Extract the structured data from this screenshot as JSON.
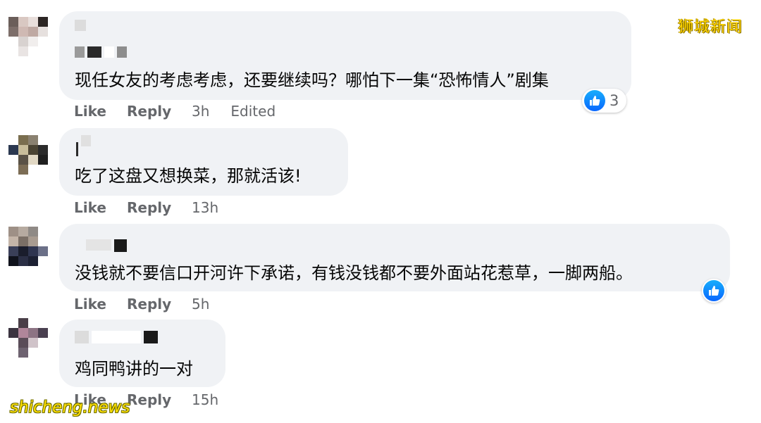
{
  "watermarks": {
    "top_right": "狮城新闻",
    "bottom_left": "shicheng.news"
  },
  "comments": [
    {
      "text": "现任女友的考虑考虑，还要继续吗？哪怕下一集“恐怖情人”剧集",
      "actions": {
        "like": "Like",
        "reply": "Reply",
        "time": "3h",
        "edited": "Edited"
      },
      "reaction": {
        "icon": "like-icon",
        "count": "3"
      }
    },
    {
      "text": "吃了这盘又想换菜，那就活该!",
      "actions": {
        "like": "Like",
        "reply": "Reply",
        "time": "13h"
      }
    },
    {
      "text": "没钱就不要信口开河许下承诺，有钱没钱都不要外面站花惹草，一脚两船。",
      "actions": {
        "like": "Like",
        "reply": "Reply",
        "time": "5h"
      },
      "reaction": {
        "icon": "like-icon"
      }
    },
    {
      "text": "鸡同鸭讲的一对",
      "actions": {
        "like": "Like",
        "reply": "Reply",
        "time": "15h"
      }
    }
  ],
  "colors": {
    "bubble": "#f0f2f5",
    "action_text": "#65676b",
    "like_blue": "#0866ff",
    "watermark_yellow": "#ffd400"
  }
}
